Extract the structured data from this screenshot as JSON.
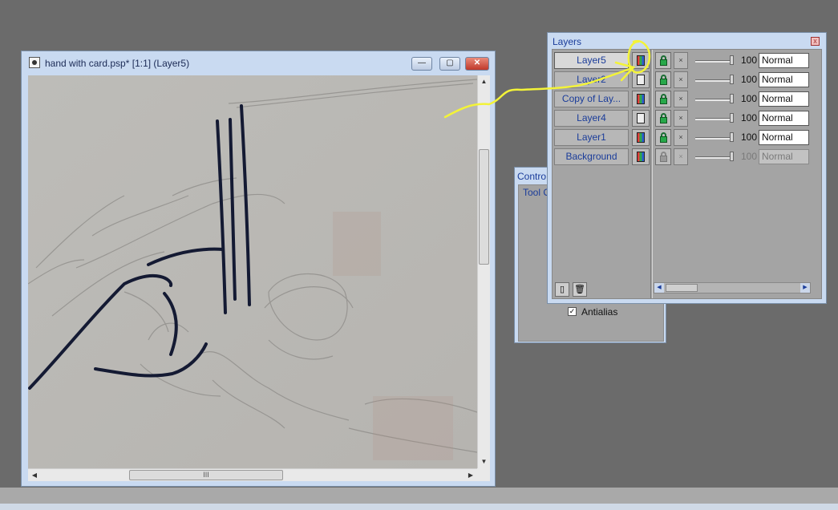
{
  "document_window": {
    "title": "hand with card.psp* [1:1] (Layer5)",
    "minimize_label": "—",
    "maximize_label": "▢",
    "close_label": "✕",
    "scroll_grip": "III"
  },
  "controls_panel": {
    "title": "Contro",
    "tab": "Tool O",
    "antialias_label": "Antialias",
    "antialias_checked": "✓"
  },
  "layers_panel": {
    "title": "Layers",
    "close_label": "x",
    "layers": [
      {
        "name": "Layer5",
        "opacity": "100",
        "blend": "Normal",
        "selected": true,
        "color_icon": true,
        "enabled": true
      },
      {
        "name": "Layer2",
        "opacity": "100",
        "blend": "Normal",
        "selected": false,
        "color_icon": false,
        "enabled": true
      },
      {
        "name": "Copy of Lay...",
        "opacity": "100",
        "blend": "Normal",
        "selected": false,
        "color_icon": true,
        "enabled": true
      },
      {
        "name": "Layer4",
        "opacity": "100",
        "blend": "Normal",
        "selected": false,
        "color_icon": false,
        "enabled": true
      },
      {
        "name": "Layer1",
        "opacity": "100",
        "blend": "Normal",
        "selected": false,
        "color_icon": true,
        "enabled": true
      },
      {
        "name": "Background",
        "opacity": "100",
        "blend": "Normal",
        "selected": false,
        "color_icon": true,
        "enabled": false
      }
    ],
    "x_glyph": "×"
  },
  "colors": {
    "annotation": "#f3f338",
    "stroke": "#141a33",
    "window_frame": "#c9daf1",
    "layer_label": "#1a3c9a"
  }
}
